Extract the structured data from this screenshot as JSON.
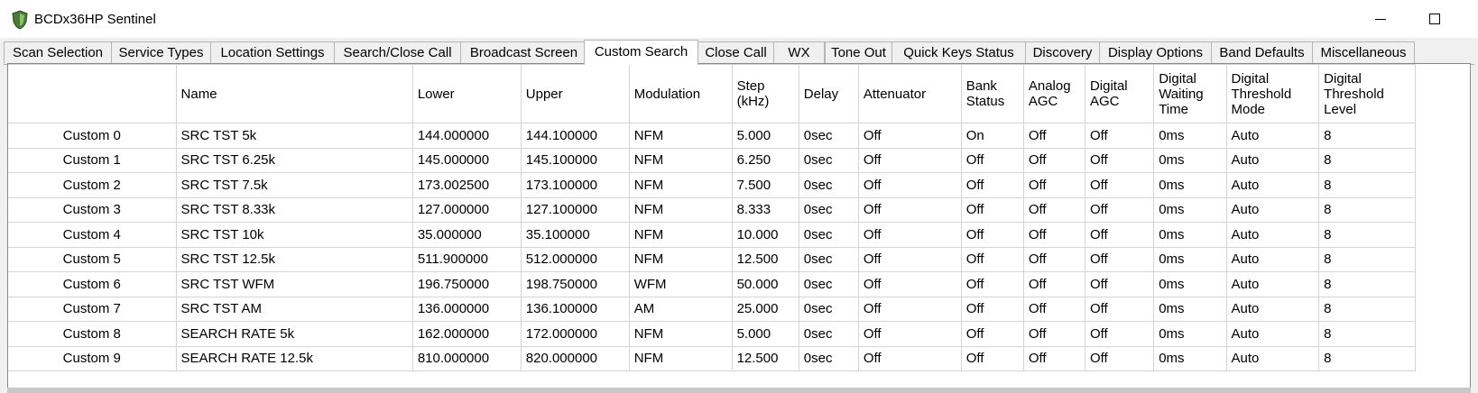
{
  "window": {
    "title": "BCDx36HP Sentinel",
    "minimize_label": "",
    "maximize_label": ""
  },
  "tabs": [
    {
      "label": "Scan Selection",
      "active": false
    },
    {
      "label": "Service Types",
      "active": false
    },
    {
      "label": "Location Settings",
      "active": false
    },
    {
      "label": "Search/Close Call",
      "active": false
    },
    {
      "label": "Broadcast Screen",
      "active": false
    },
    {
      "label": "Custom Search",
      "active": true
    },
    {
      "label": "Close Call",
      "active": false
    },
    {
      "label": "WX",
      "active": false
    },
    {
      "label": "Tone Out",
      "active": false
    },
    {
      "label": "Quick Keys Status",
      "active": false
    },
    {
      "label": "Discovery",
      "active": false
    },
    {
      "label": "Display Options",
      "active": false
    },
    {
      "label": "Band Defaults",
      "active": false
    },
    {
      "label": "Miscellaneous",
      "active": false
    }
  ],
  "table": {
    "columns": [
      "Name",
      "Lower",
      "Upper",
      "Modulation",
      "Step (kHz)",
      "Delay",
      "Attenuator",
      "Bank Status",
      "Analog AGC",
      "Digital AGC",
      "Digital Waiting Time",
      "Digital Threshold Mode",
      "Digital Threshold Level"
    ],
    "rows": [
      {
        "label": "Custom 0",
        "cells": [
          "SRC TST 5k",
          "144.000000",
          "144.100000",
          "NFM",
          "5.000",
          "0sec",
          "Off",
          "On",
          "Off",
          "Off",
          "0ms",
          "Auto",
          "8"
        ]
      },
      {
        "label": "Custom 1",
        "cells": [
          "SRC TST 6.25k",
          "145.000000",
          "145.100000",
          "NFM",
          "6.250",
          "0sec",
          "Off",
          "Off",
          "Off",
          "Off",
          "0ms",
          "Auto",
          "8"
        ]
      },
      {
        "label": "Custom 2",
        "cells": [
          "SRC TST 7.5k",
          "173.002500",
          "173.100000",
          "NFM",
          "7.500",
          "0sec",
          "Off",
          "Off",
          "Off",
          "Off",
          "0ms",
          "Auto",
          "8"
        ]
      },
      {
        "label": "Custom 3",
        "cells": [
          "SRC TST 8.33k",
          "127.000000",
          "127.100000",
          "NFM",
          "8.333",
          "0sec",
          "Off",
          "Off",
          "Off",
          "Off",
          "0ms",
          "Auto",
          "8"
        ]
      },
      {
        "label": "Custom 4",
        "cells": [
          "SRC TST 10k",
          "35.000000",
          "35.100000",
          "NFM",
          "10.000",
          "0sec",
          "Off",
          "Off",
          "Off",
          "Off",
          "0ms",
          "Auto",
          "8"
        ]
      },
      {
        "label": "Custom 5",
        "cells": [
          "SRC TST 12.5k",
          "511.900000",
          "512.000000",
          "NFM",
          "12.500",
          "0sec",
          "Off",
          "Off",
          "Off",
          "Off",
          "0ms",
          "Auto",
          "8"
        ]
      },
      {
        "label": "Custom 6",
        "cells": [
          "SRC TST WFM",
          "196.750000",
          "198.750000",
          "WFM",
          "50.000",
          "0sec",
          "Off",
          "Off",
          "Off",
          "Off",
          "0ms",
          "Auto",
          "8"
        ]
      },
      {
        "label": "Custom 7",
        "cells": [
          "SRC TST AM",
          "136.000000",
          "136.100000",
          "AM",
          "25.000",
          "0sec",
          "Off",
          "Off",
          "Off",
          "Off",
          "0ms",
          "Auto",
          "8"
        ]
      },
      {
        "label": "Custom 8",
        "cells": [
          "SEARCH RATE 5k",
          "162.000000",
          "172.000000",
          "NFM",
          "5.000",
          "0sec",
          "Off",
          "Off",
          "Off",
          "Off",
          "0ms",
          "Auto",
          "8"
        ]
      },
      {
        "label": "Custom 9",
        "cells": [
          "SEARCH RATE 12.5k",
          "810.000000",
          "820.000000",
          "NFM",
          "12.500",
          "0sec",
          "Off",
          "Off",
          "Off",
          "Off",
          "0ms",
          "Auto",
          "8"
        ]
      }
    ]
  },
  "icons": {
    "app": "shield-icon",
    "minimize": "minimize-icon",
    "maximize": "maximize-icon"
  },
  "colors": {
    "grid_line": "#d4d4d4",
    "tab_border": "#b5b5b5",
    "background": "#f0f0f0"
  }
}
